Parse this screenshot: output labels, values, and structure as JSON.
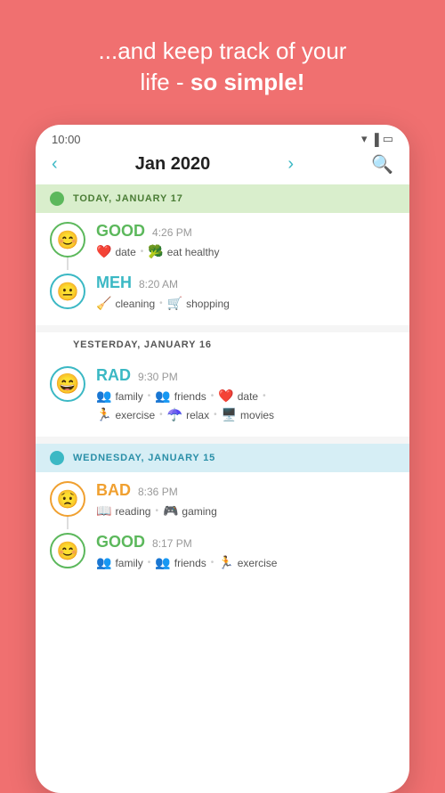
{
  "header": {
    "line1": "...and keep track of your",
    "line2_normal": "life - ",
    "line2_bold": "so simple!"
  },
  "status_bar": {
    "time": "10:00"
  },
  "nav": {
    "title": "Jan 2020",
    "prev_arrow": "‹",
    "next_arrow": "›"
  },
  "days": [
    {
      "id": "today",
      "label": "TODAY, JANUARY 17",
      "dot_color": "green",
      "entries": [
        {
          "mood": "GOOD",
          "mood_key": "good",
          "time": "4:26 PM",
          "emoji": "😊",
          "tags": [
            {
              "icon": "❤️",
              "label": "date"
            },
            {
              "icon": "🥦",
              "label": "eat healthy"
            }
          ]
        },
        {
          "mood": "MEH",
          "mood_key": "meh",
          "time": "8:20 AM",
          "emoji": "😐",
          "tags": [
            {
              "icon": "🧹",
              "label": "cleaning"
            },
            {
              "icon": "🛒",
              "label": "shopping"
            }
          ]
        }
      ]
    },
    {
      "id": "yesterday",
      "label": "YESTERDAY, JANUARY 16",
      "dot_color": null,
      "entries": [
        {
          "mood": "RAD",
          "mood_key": "rad",
          "time": "9:30 PM",
          "emoji": "😄",
          "tags": [
            {
              "icon": "👥",
              "label": "family"
            },
            {
              "icon": "👥",
              "label": "friends"
            },
            {
              "icon": "❤️",
              "label": "date"
            },
            {
              "icon": "🏃",
              "label": "exercise"
            },
            {
              "icon": "☂️",
              "label": "relax"
            },
            {
              "icon": "🖥️",
              "label": "movies"
            }
          ]
        }
      ]
    },
    {
      "id": "wednesday",
      "label": "WEDNESDAY, JANUARY 15",
      "dot_color": "teal",
      "entries": [
        {
          "mood": "BAD",
          "mood_key": "bad",
          "time": "8:36 PM",
          "emoji": "😟",
          "tags": [
            {
              "icon": "📖",
              "label": "reading"
            },
            {
              "icon": "🎮",
              "label": "gaming"
            }
          ]
        },
        {
          "mood": "GOOD",
          "mood_key": "good2",
          "time": "8:17 PM",
          "emoji": "😊",
          "tags": [
            {
              "icon": "👥",
              "label": "family"
            },
            {
              "icon": "👥",
              "label": "friends"
            },
            {
              "icon": "🏃",
              "label": "exercise"
            }
          ]
        }
      ]
    }
  ]
}
